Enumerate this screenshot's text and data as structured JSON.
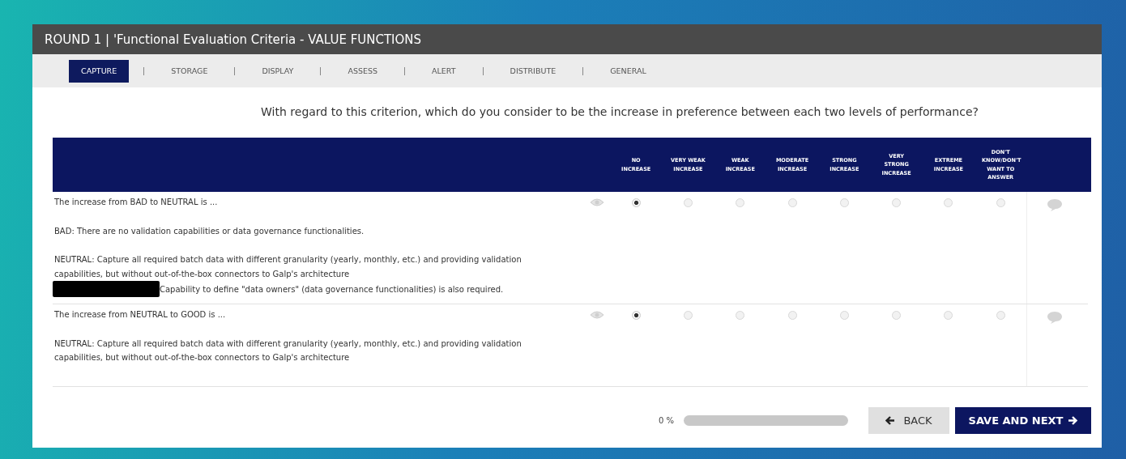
{
  "window": {
    "title": "ROUND 1 | 'Functional Evaluation Criteria - VALUE FUNCTIONS"
  },
  "tabs": [
    {
      "label": "CAPTURE",
      "selected": true
    },
    {
      "label": "STORAGE",
      "selected": false
    },
    {
      "label": "DISPLAY",
      "selected": false
    },
    {
      "label": "ASSESS",
      "selected": false
    },
    {
      "label": "ALERT",
      "selected": false
    },
    {
      "label": "DISTRIBUTE",
      "selected": false
    },
    {
      "label": "GENERAL",
      "selected": false
    }
  ],
  "question": "With regard to this criterion, which do you consider to be the increase in preference between each two levels of performance?",
  "table": {
    "columns": [
      "NO INCREASE",
      "VERY WEAK INCREASE",
      "WEAK INCREASE",
      "MODERATE INCREASE",
      "STRONG INCREASE",
      "VERY STRONG INCREASE",
      "EXTREME INCREASE",
      "DON'T KNOW/DON'T WANT TO ANSWER"
    ],
    "rows": [
      {
        "prompt": "The increase from BAD to NEUTRAL is ...",
        "first_level": "BAD: There are no validation capabilities or data governance functionalities.",
        "second_level": "NEUTRAL: Capture all required batch data with different granularity (yearly, monthly, etc.) and providing validation capabilities, but without out-of-the-box connectors to Galp's architecture",
        "after_redaction": "Capability to define \"data owners\" (data governance functionalities) is also required.",
        "choices": [
          {
            "selected": true
          },
          {
            "selected": false
          },
          {
            "selected": false
          },
          {
            "selected": false
          },
          {
            "selected": false
          },
          {
            "selected": false
          },
          {
            "selected": false
          },
          {
            "selected": false
          }
        ]
      },
      {
        "prompt": "The increase from NEUTRAL to GOOD is ...",
        "first_level": "NEUTRAL: Capture all required batch data with different granularity (yearly, monthly, etc.) and providing validation capabilities, but without out-of-the-box connectors to Galp's architecture",
        "choices": [
          {
            "selected": true
          },
          {
            "selected": false
          },
          {
            "selected": false
          },
          {
            "selected": false
          },
          {
            "selected": false
          },
          {
            "selected": false
          },
          {
            "selected": false
          },
          {
            "selected": false
          }
        ]
      }
    ]
  },
  "progress": {
    "reading": "0 %",
    "level": 0
  },
  "buttons": {
    "back": "BACK",
    "next": "SAVE AND NEXT"
  }
}
